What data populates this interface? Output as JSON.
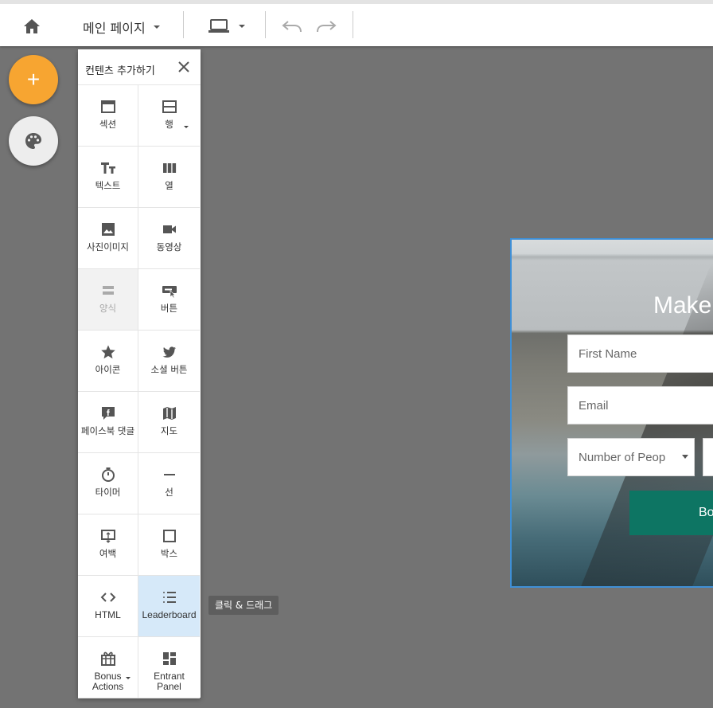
{
  "toolbar": {
    "home_icon": "home-icon",
    "page_select_label": "메인 페이지",
    "device_icon": "laptop-icon",
    "undo_icon": "undo-icon",
    "redo_icon": "redo-icon"
  },
  "fabs": {
    "add_label": "+",
    "theme_icon": "palette-icon",
    "add_color": "#f7a531"
  },
  "panel": {
    "title": "컨텐츠 추가하기",
    "items": [
      {
        "label": "섹션",
        "icon": "section-icon"
      },
      {
        "label": "행",
        "icon": "row-icon"
      },
      {
        "label": "텍스트",
        "icon": "text-icon"
      },
      {
        "label": "열",
        "icon": "columns-icon"
      },
      {
        "label": "사진이미지",
        "icon": "image-icon"
      },
      {
        "label": "동영상",
        "icon": "video-icon"
      },
      {
        "label": "양식",
        "icon": "form-icon"
      },
      {
        "label": "버튼",
        "icon": "button-icon"
      },
      {
        "label": "아이콘",
        "icon": "star-icon"
      },
      {
        "label": "소셜 버튼",
        "icon": "twitter-icon"
      },
      {
        "label": "페이스북 댓글",
        "icon": "facebook-comment-icon"
      },
      {
        "label": "지도",
        "icon": "map-icon"
      },
      {
        "label": "타이머",
        "icon": "timer-icon"
      },
      {
        "label": "선",
        "icon": "line-icon"
      },
      {
        "label": "여백",
        "icon": "spacer-icon"
      },
      {
        "label": "박스",
        "icon": "box-icon"
      },
      {
        "label": "HTML",
        "icon": "code-icon"
      },
      {
        "label": "Leaderboard",
        "icon": "leaderboard-icon"
      },
      {
        "label": "Bonus Actions",
        "icon": "gift-icon"
      },
      {
        "label": "Entrant Panel",
        "icon": "dashboard-icon"
      }
    ]
  },
  "tooltip": "클릭 & 드래그",
  "preview": {
    "title": "Make",
    "first_name_placeholder": "First Name",
    "email_placeholder": "Email",
    "people_select": "Number of Peop",
    "button_label": "Bo",
    "button_color": "#0d7563"
  }
}
